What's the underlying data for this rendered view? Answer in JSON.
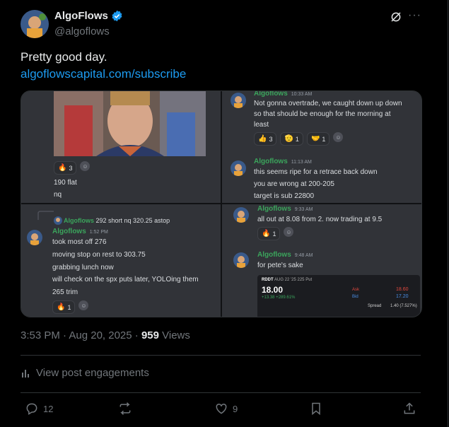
{
  "author": {
    "name": "AlgoFlows",
    "handle": "@algoflows"
  },
  "post": {
    "text": "Pretty good day.",
    "link": "algoflowscapital.com/subscribe"
  },
  "media": {
    "q1": {
      "reactions": [
        {
          "emoji": "🔥",
          "count": "3"
        }
      ],
      "lines": [
        "190 flat",
        "nq"
      ]
    },
    "q2": {
      "msg1": {
        "name": "Algoflows",
        "time": "10:33 AM",
        "lines": [
          "Not gonna overtrade, we caught down up down",
          "so that should be enough for the morning at",
          "least"
        ],
        "reactions": [
          {
            "emoji": "👍",
            "count": "3"
          },
          {
            "emoji": "🫡",
            "count": "1"
          },
          {
            "emoji": "🤝",
            "count": "1"
          }
        ]
      },
      "msg2": {
        "name": "Algoflows",
        "time": "11:13 AM",
        "lines": [
          "this seems ripe for a retrace back down",
          "you are wrong at 200-205",
          "target is sub 22800"
        ]
      }
    },
    "q3": {
      "reply": {
        "name": "Algoflows",
        "text": "292 short nq 320.25 astop"
      },
      "name": "Algoflows",
      "time": "1:52 PM",
      "lines": [
        "took most off 276",
        "moving stop on rest to 303.75",
        "grabbing lunch now",
        "will check on the spx puts later, YOLOing them",
        "265 trim"
      ],
      "reactions": [
        {
          "emoji": "🔥",
          "count": "1"
        }
      ]
    },
    "q4": {
      "msg1": {
        "name": "Algoflows",
        "time": "9:33 AM",
        "lines": [
          "all out at 8.08 from 2. now trading at 9.5"
        ],
        "reactions": [
          {
            "emoji": "🔥",
            "count": "1"
          }
        ]
      },
      "msg2": {
        "name": "Algoflows",
        "time": "9:48 AM",
        "lines": [
          "for pete's sake"
        ]
      },
      "quote": {
        "symbol": "RDDT",
        "desc": "AUG 22 '25 225 Put",
        "price": "18.00",
        "change": "+13.38 +289.61%",
        "ask_label": "Ask",
        "bid_label": "Bid",
        "ask": "18.60",
        "bid": "17.20",
        "spread_label": "Spread",
        "spread": "1.40 (7.527%)"
      }
    }
  },
  "meta": {
    "time": "3:53 PM · Aug 20, 2025 · ",
    "views_count": "959",
    "views_label": " Views"
  },
  "engagements_label": "View post engagements",
  "actions": {
    "replies": "12",
    "likes": "9"
  }
}
